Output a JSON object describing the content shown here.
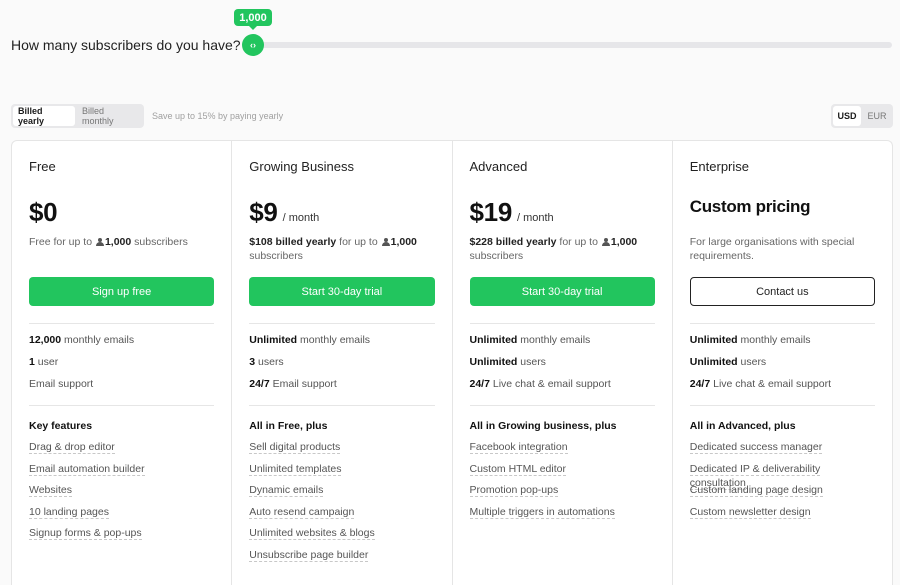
{
  "slider": {
    "question": "How many subscribers do you have?",
    "value_label": "1,000",
    "handle_glyph": "‹›"
  },
  "billing": {
    "options": [
      "Billed yearly",
      "Billed monthly"
    ],
    "selected": "Billed yearly",
    "save_note": "Save up to 15% by paying yearly"
  },
  "currency": {
    "options": [
      "USD",
      "EUR"
    ],
    "selected": "USD"
  },
  "colors": {
    "accent": "#22c55e",
    "border": "#e5e5e5"
  },
  "plans": [
    {
      "name": "Free",
      "price": "$0",
      "period": "",
      "desc_bold": "",
      "desc_text": "Free for up to",
      "desc_count": "1,000",
      "desc_tail": "subscribers",
      "cta": "Sign up free",
      "summary": [
        {
          "bold": "12,000",
          "text": " monthly emails"
        },
        {
          "bold": "1",
          "text": " user"
        },
        {
          "bold": "",
          "text": "Email support"
        }
      ],
      "features_title": "Key features",
      "features": [
        "Drag & drop editor",
        "Email automation builder",
        "Websites",
        "10 landing pages",
        "Signup forms & pop-ups"
      ]
    },
    {
      "name": "Growing Business",
      "price": "$9",
      "period": "/ month",
      "desc_bold": "$108 billed yearly",
      "desc_text": "for up to",
      "desc_count": "1,000",
      "desc_tail": "subscribers",
      "cta": "Start 30-day trial",
      "summary": [
        {
          "bold": "Unlimited",
          "text": " monthly emails"
        },
        {
          "bold": "3",
          "text": " users"
        },
        {
          "bold": "24/7",
          "text": " Email support"
        }
      ],
      "features_title": "All in Free, plus",
      "features": [
        "Sell digital products",
        "Unlimited templates",
        "Dynamic emails",
        "Auto resend campaign",
        "Unlimited websites & blogs",
        "Unsubscribe page builder"
      ]
    },
    {
      "name": "Advanced",
      "price": "$19",
      "period": "/ month",
      "desc_bold": "$228 billed yearly",
      "desc_text": "for up to",
      "desc_count": "1,000",
      "desc_tail": "subscribers",
      "cta": "Start 30-day trial",
      "summary": [
        {
          "bold": "Unlimited",
          "text": " monthly emails"
        },
        {
          "bold": "Unlimited",
          "text": " users"
        },
        {
          "bold": "24/7",
          "text": " Live chat & email support"
        }
      ],
      "features_title": "All in Growing business, plus",
      "features": [
        "Facebook integration",
        "Custom HTML editor",
        "Promotion pop-ups",
        "Multiple triggers in automations"
      ]
    },
    {
      "name": "Enterprise",
      "price": "Custom pricing",
      "period": "",
      "desc_plain": "For large organisations with special requirements.",
      "cta": "Contact us",
      "summary": [
        {
          "bold": "Unlimited",
          "text": " monthly emails"
        },
        {
          "bold": "Unlimited",
          "text": " users"
        },
        {
          "bold": "24/7",
          "text": " Live chat & email support"
        }
      ],
      "features_title": "All in Advanced, plus",
      "features": [
        "Dedicated success manager",
        "Dedicated IP & deliverability consultation",
        "Custom landing page design",
        "Custom newsletter design"
      ]
    }
  ]
}
